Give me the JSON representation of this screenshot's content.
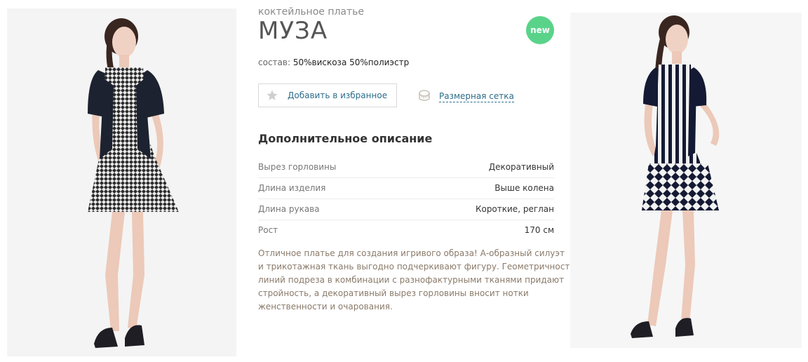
{
  "product": {
    "type_label": "коктейльное платье",
    "title": "МУЗА",
    "badge": "new",
    "composition_label": "состав:",
    "composition_value": "50%вискоза 50%полиэстр"
  },
  "actions": {
    "favorite_label": "Добавить в избранное",
    "size_chart_label": "Размерная сетка"
  },
  "details": {
    "section_title": "Дополнительное описание",
    "specs": [
      {
        "key": "Вырез горловины",
        "value": "Декоративный"
      },
      {
        "key": "Длина изделия",
        "value": "Выше колена"
      },
      {
        "key": "Длина рукава",
        "value": "Короткие, реглан"
      },
      {
        "key": "Рост",
        "value": "170 см"
      }
    ],
    "description_lines": [
      "Отличное платье для создания игривого образа! А-образный силуэт",
      "и трикотажная ткань выгодно подчеркивают фигуру. Геометричность",
      "линий подреза в комбинации с разнофактурными тканями придают",
      "стройность, а декоративный вырез горловины вносит нотки",
      "женственности и очарования."
    ]
  },
  "colors": {
    "badge_bg": "#5ad38a",
    "link": "#2a6d8a",
    "description_text": "#8a7a6a"
  },
  "icons": {
    "favorite": "star-icon",
    "size_chart": "measuring-tape-icon"
  }
}
